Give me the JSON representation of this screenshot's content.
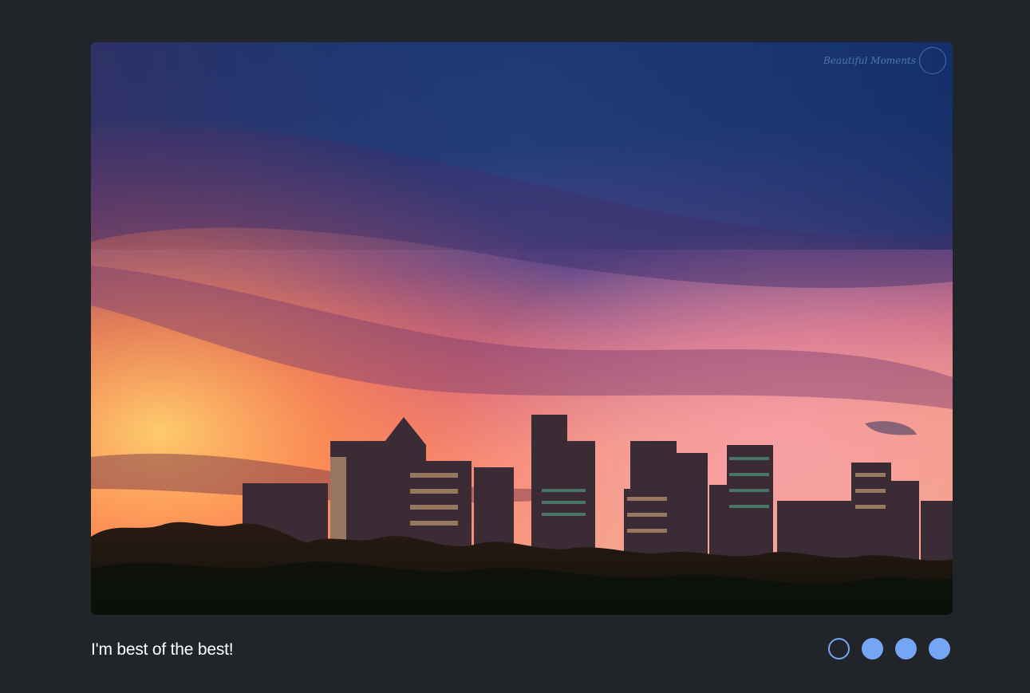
{
  "slide": {
    "caption": "I'm best of the best!",
    "image_subject": "city skyline at sunset",
    "watermark": "Beautiful Moments"
  },
  "indicators": [
    {
      "active": true
    },
    {
      "active": false
    },
    {
      "active": false
    },
    {
      "active": false
    }
  ],
  "colors": {
    "background": "#212529",
    "indicator": "#74a6f5",
    "caption": "#ffffff"
  }
}
